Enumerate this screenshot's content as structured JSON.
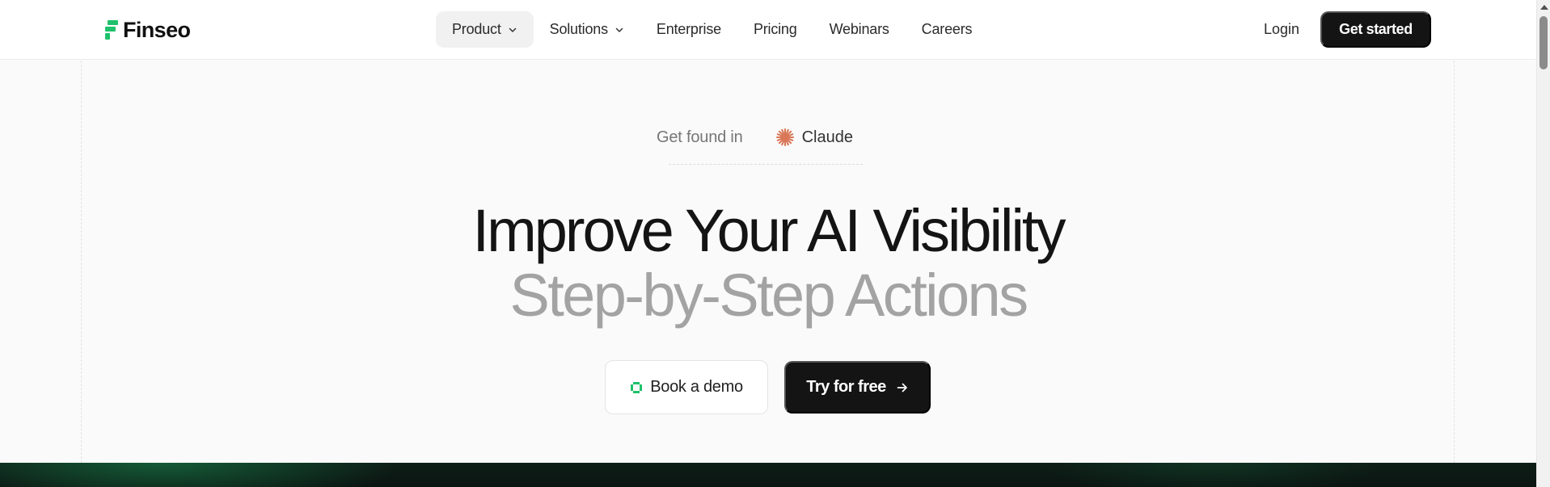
{
  "brand": {
    "name": "Finseo",
    "accent_color": "#1fc16b"
  },
  "nav": {
    "items": [
      {
        "label": "Product",
        "has_dropdown": true,
        "active": true
      },
      {
        "label": "Solutions",
        "has_dropdown": true,
        "active": false
      },
      {
        "label": "Enterprise",
        "has_dropdown": false,
        "active": false
      },
      {
        "label": "Pricing",
        "has_dropdown": false,
        "active": false
      },
      {
        "label": "Webinars",
        "has_dropdown": false,
        "active": false
      },
      {
        "label": "Careers",
        "has_dropdown": false,
        "active": false
      }
    ],
    "login_label": "Login",
    "cta_label": "Get started"
  },
  "hero": {
    "found_prefix": "Get found in",
    "found_platform": "Claude",
    "platform_icon": "claude-sparkle-icon",
    "platform_icon_color": "#d97757",
    "headline_line1": "Improve Your AI Visibility",
    "headline_line2": "Step-by-Step Actions",
    "demo_button_label": "Book a demo",
    "demo_icon": "demo-ring-icon",
    "try_button_label": "Try for free",
    "try_icon": "arrow-right-icon"
  },
  "theme": {
    "primary_dark": "#141414",
    "muted_text": "#a3a3a3",
    "background": "#fafafa"
  }
}
